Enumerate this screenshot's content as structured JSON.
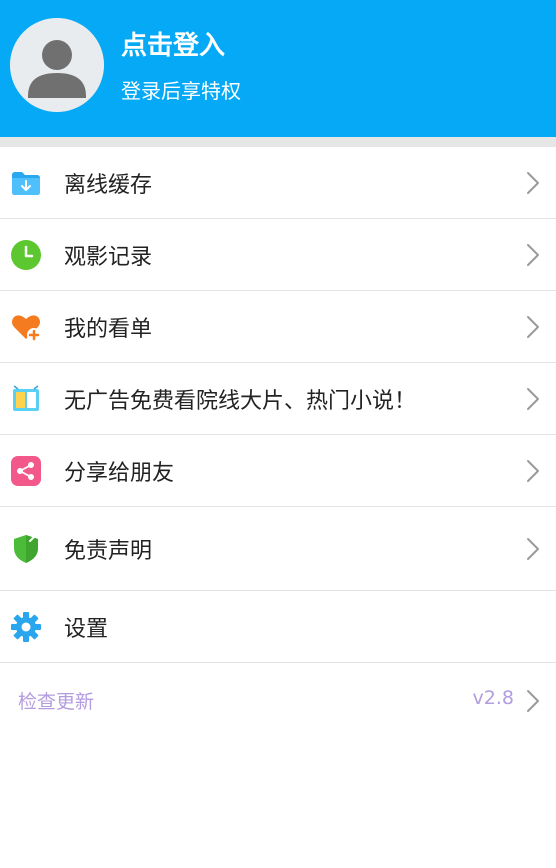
{
  "header": {
    "title": "点击登入",
    "subtitle": "登录后享特权",
    "bg_color": "#05a9f5",
    "avatar_icon": "user-avatar-icon"
  },
  "menu": [
    {
      "label": "离线缓存",
      "icon": "download-folder-icon"
    },
    {
      "label": "观影记录",
      "icon": "clock-history-icon"
    },
    {
      "label": "我的看单",
      "icon": "heart-plus-icon"
    },
    {
      "label": "无广告免费看院线大片、热门小说！",
      "icon": "app-promo-icon"
    },
    {
      "label": "分享给朋友",
      "icon": "share-icon"
    },
    {
      "label": "免责声明",
      "icon": "shield-icon"
    },
    {
      "label": "设置",
      "icon": "gear-icon"
    }
  ],
  "update": {
    "label": "检查更新",
    "version": "v2.8",
    "color": "#b39ce0"
  }
}
